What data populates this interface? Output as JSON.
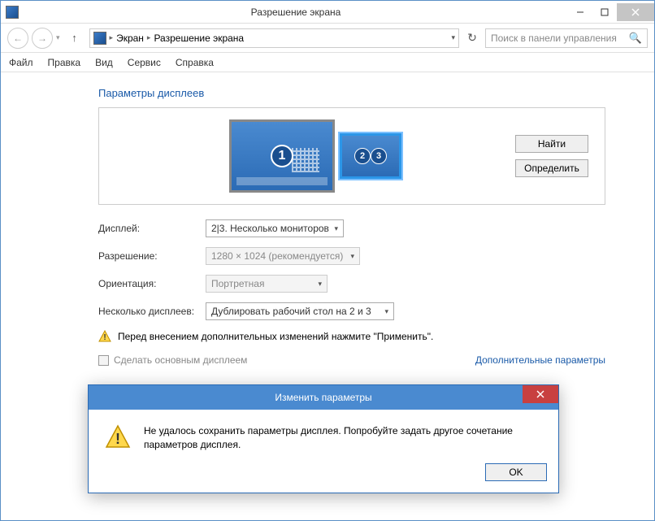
{
  "window": {
    "title": "Разрешение экрана",
    "minimize": "—",
    "maximize": "□",
    "close": "×"
  },
  "breadcrumb": {
    "item1": "Экран",
    "item2": "Разрешение экрана"
  },
  "search": {
    "placeholder": "Поиск в панели управления"
  },
  "menu": {
    "file": "Файл",
    "edit": "Правка",
    "view": "Вид",
    "service": "Сервис",
    "help": "Справка"
  },
  "heading": "Параметры дисплеев",
  "monitors": {
    "m1": "1",
    "m2": "2",
    "m3": "3"
  },
  "buttons": {
    "find": "Найти",
    "detect": "Определить"
  },
  "labels": {
    "display": "Дисплей:",
    "resolution": "Разрешение:",
    "orientation": "Ориентация:",
    "multiple": "Несколько дисплеев:"
  },
  "values": {
    "display": "2|3. Несколько мониторов",
    "resolution": "1280 × 1024 (рекомендуется)",
    "orientation": "Портретная",
    "multiple": "Дублировать рабочий стол на 2 и 3"
  },
  "warning_text": "Перед внесением дополнительных изменений нажмите \"Применить\".",
  "checkbox_label": "Сделать основным дисплеем",
  "advanced_link": "Дополнительные параметры",
  "modal": {
    "title": "Изменить параметры",
    "message": "Не удалось сохранить параметры дисплея. Попробуйте задать другое сочетание параметров дисплея.",
    "ok": "OK"
  }
}
